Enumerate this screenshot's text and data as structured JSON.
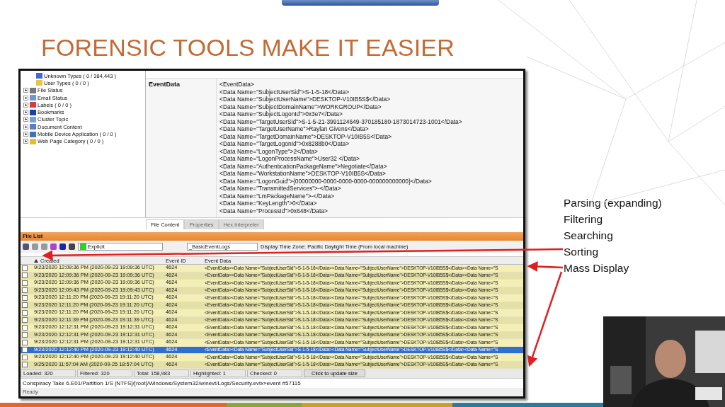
{
  "slide": {
    "title": "FORENSIC TOOLS MAKE IT EASIER",
    "bullets": [
      "Parsing (expanding)",
      "Filtering",
      "Searching",
      "Sorting",
      "Mass Display"
    ]
  },
  "app": {
    "tree": [
      {
        "label": "Unknown Types ( 0 / 384,443 )",
        "expandable": false
      },
      {
        "label": "User Types ( 0 / 0 )",
        "expandable": false
      },
      {
        "label": "File Status",
        "expandable": true
      },
      {
        "label": "Email Status",
        "expandable": true
      },
      {
        "label": "Labels ( 0 / 0 )",
        "expandable": true
      },
      {
        "label": "Bookmarks",
        "expandable": true
      },
      {
        "label": "Cluster Topic",
        "expandable": true
      },
      {
        "label": "Document Content",
        "expandable": true
      },
      {
        "label": "Mobile Device Application ( 0 / 0 )",
        "expandable": true
      },
      {
        "label": "Web Page Category ( 0 / 0 )",
        "expandable": true
      }
    ],
    "field_label": "EventData",
    "event_lines": [
      "<EventData>",
      "<Data Name=\"SubjectUserSid\">S-1-5-18</Data>",
      "<Data Name=\"SubjectUserName\">DESKTOP-V10IB5S$</Data>",
      "<Data Name=\"SubjectDomainName\">WORKGROUP</Data>",
      "<Data Name=\"SubjectLogonId\">0x3e7</Data>",
      "<Data Name=\"TargetUserSid\">S-1-5-21-3991124649-370185180-1873014723-1001</Data>",
      "<Data Name=\"TargetUserName\">Raylan Givens</Data>",
      "<Data Name=\"TargetDomainName\">DESKTOP-V10IB5S</Data>",
      "<Data Name=\"TargetLogonId\">0x8288b0</Data>",
      "<Data Name=\"LogonType\">2</Data>",
      "<Data Name=\"LogonProcessName\">User32 </Data>",
      "<Data Name=\"AuthenticationPackageName\">Negotiate</Data>",
      "<Data Name=\"WorkstationName\">DESKTOP-V10IB5S</Data>",
      "<Data Name=\"LogonGuid\">{00000000-0000-0000-0000-000000000000}</Data>",
      "<Data Name=\"TransmittedServices\">-</Data>",
      "<Data Name=\"LmPackageName\">-</Data>",
      "<Data Name=\"KeyLength\">0</Data>",
      "<Data Name=\"ProcessId\">0x648</Data>"
    ],
    "tabs": [
      {
        "label": "File Content",
        "selected": true
      },
      {
        "label": "Properties",
        "selected": false
      },
      {
        "label": "Hex Interpreter",
        "selected": false
      }
    ],
    "file_list": {
      "title": "File List",
      "filter": "Explicit",
      "view": "_BasicEventLogs",
      "time_zone": "Display Time Zone: Pacific Daylight Time  (From local machine)",
      "columns": [
        "Created",
        "Event ID",
        "Event Data"
      ],
      "rows": [
        {
          "created": "9/23/2020 12:09:36 PM (2020-09-23 19:09:36 UTC)",
          "event_id": "4624",
          "event_data": "<EventData><Data Name=\"SubjectUserSid\">S-1-5-18</Data><Data Name=\"SubjectUserName\">DESKTOP-V10IB5S$</Data><Data Name=\"S",
          "selected": false,
          "checked": false
        },
        {
          "created": "9/23/2020 12:09:36 PM (2020-09-23 19:09:36 UTC)",
          "event_id": "4624",
          "event_data": "<EventData><Data Name=\"SubjectUserSid\">S-1-5-18</Data><Data Name=\"SubjectUserName\">DESKTOP-V10IB5S$</Data><Data Name=\"S",
          "selected": false,
          "checked": false
        },
        {
          "created": "9/23/2020 12:09:36 PM (2020-09-23 19:09:36 UTC)",
          "event_id": "4624",
          "event_data": "<EventData><Data Name=\"SubjectUserSid\">S-1-5-18</Data><Data Name=\"SubjectUserName\">DESKTOP-V10IB5S$</Data><Data Name=\"S",
          "selected": false,
          "checked": false
        },
        {
          "created": "9/23/2020 12:09:43 PM (2020-09-23 19:09:43 UTC)",
          "event_id": "4624",
          "event_data": "<EventData><Data Name=\"SubjectUserSid\">S-1-5-18</Data><Data Name=\"SubjectUserName\">DESKTOP-V10IB5S$</Data><Data Name=\"S",
          "selected": false,
          "checked": false
        },
        {
          "created": "9/23/2020 12:11:20 PM (2020-09-23 19:11:20 UTC)",
          "event_id": "4624",
          "event_data": "<EventData><Data Name=\"SubjectUserSid\">S-1-5-18</Data><Data Name=\"SubjectUserName\">DESKTOP-V10IB5S$</Data><Data Name=\"S",
          "selected": false,
          "checked": false
        },
        {
          "created": "9/23/2020 12:11:20 PM (2020-09-23 19:11:20 UTC)",
          "event_id": "4624",
          "event_data": "<EventData><Data Name=\"SubjectUserSid\">S-1-5-18</Data><Data Name=\"SubjectUserName\">DESKTOP-V10IB5S$</Data><Data Name=\"S",
          "selected": false,
          "checked": false
        },
        {
          "created": "9/23/2020 12:11:20 PM (2020-09-23 19:11:20 UTC)",
          "event_id": "4624",
          "event_data": "<EventData><Data Name=\"SubjectUserSid\">S-1-5-18</Data><Data Name=\"SubjectUserName\">DESKTOP-V10IB5S$</Data><Data Name=\"S",
          "selected": false,
          "checked": false
        },
        {
          "created": "9/23/2020 12:11:39 PM (2020-09-23 19:11:39 UTC)",
          "event_id": "4624",
          "event_data": "<EventData><Data Name=\"SubjectUserSid\">S-1-5-18</Data><Data Name=\"SubjectUserName\">DESKTOP-V10IB5S$</Data><Data Name=\"S",
          "selected": false,
          "checked": false
        },
        {
          "created": "9/23/2020 12:12:31 PM (2020-09-23 19:12:31 UTC)",
          "event_id": "4624",
          "event_data": "<EventData><Data Name=\"SubjectUserSid\">S-1-5-18</Data><Data Name=\"SubjectUserName\">DESKTOP-V10IB5S$</Data><Data Name=\"S",
          "selected": false,
          "checked": false
        },
        {
          "created": "9/23/2020 12:12:31 PM (2020-09-23 19:12:31 UTC)",
          "event_id": "4624",
          "event_data": "<EventData><Data Name=\"SubjectUserSid\">S-1-5-18</Data><Data Name=\"SubjectUserName\">DESKTOP-V10IB5S$</Data><Data Name=\"S",
          "selected": false,
          "checked": false
        },
        {
          "created": "9/23/2020 12:12:31 PM (2020-09-23 19:12:31 UTC)",
          "event_id": "4624",
          "event_data": "<EventData><Data Name=\"SubjectUserSid\">S-1-5-18</Data><Data Name=\"SubjectUserName\">DESKTOP-V10IB5S$</Data><Data Name=\"S",
          "selected": false,
          "checked": false
        },
        {
          "created": "9/23/2020 12:12:40 PM (2020-09-23 19:12:40 UTC)",
          "event_id": "4624",
          "event_data": "<EventData><Data Name=\"SubjectUserSid\">S-1-5-18</Data><Data Name=\"SubjectUserName\">DESKTOP-V10IB5S$</Data><Data Name=\"S",
          "selected": true,
          "checked": false
        },
        {
          "created": "9/23/2020 12:12:40 PM (2020-09-23 19:12:40 UTC)",
          "event_id": "4624",
          "event_data": "<EventData><Data Name=\"SubjectUserSid\">S-1-5-18</Data><Data Name=\"SubjectUserName\">DESKTOP-V10IB5S$</Data><Data Name=\"S",
          "selected": false,
          "checked": false
        },
        {
          "created": "9/25/2020 11:57:04 AM (2020-09-25 18:57:04 UTC)",
          "event_id": "4624",
          "event_data": "<EventData><Data Name=\"SubjectUserSid\">S-1-5-18</Data><Data Name=\"SubjectUserName\">DESKTOP-V10IB5S$</Data><Data Name=\"S",
          "selected": false,
          "checked": false
        }
      ]
    },
    "status_counts": [
      "Loaded: 320",
      "Filtered: 320",
      "Total: 158,983",
      "Highlighted: 1",
      "Checked: 0"
    ],
    "update_button": "Click to update size",
    "path": "Conspiracy Take 6.E01/Partition 1/S [NTFS]/[root]/Windows/System32/winevt/Logs/Security.evtx»event #57115",
    "ready": "Ready"
  }
}
